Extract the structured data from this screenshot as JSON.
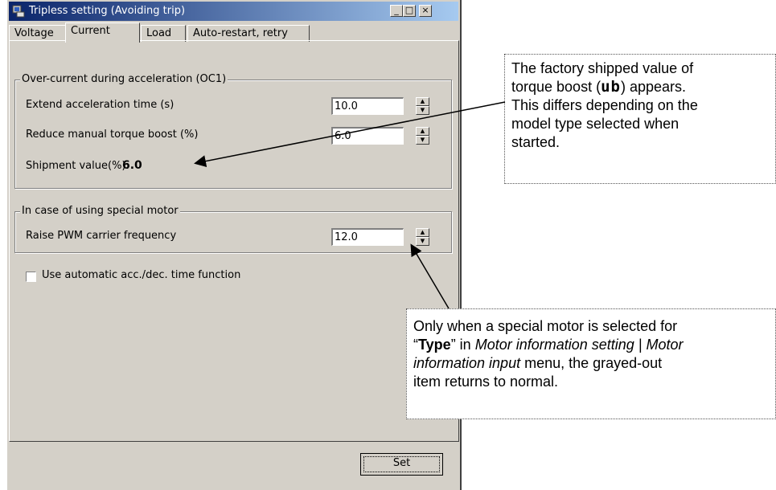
{
  "window": {
    "title": "Tripless setting (Avoiding trip)",
    "minimize": "_",
    "maximize": "□",
    "close": "×"
  },
  "tabs": [
    "Voltage",
    "Current",
    "Load",
    "Auto-restart, retry"
  ],
  "active_tab": "Current",
  "oc1_group": {
    "legend": "Over-current during acceleration (OC1)",
    "extend_label": "Extend acceleration time (s)",
    "extend_value": "10.0",
    "reduce_label": "Reduce manual torque boost (%)",
    "reduce_value": "6.0",
    "shipment_label": "Shipment value(%):",
    "shipment_value": "6.0"
  },
  "motor_group": {
    "legend": "In case of using special motor",
    "pwm_label": "Raise PWM carrier frequency",
    "pwm_value": "12.0"
  },
  "auto_acc_label": "Use automatic acc./dec. time function",
  "set_button": "Set",
  "callout1": {
    "line1": "The factory shipped value of",
    "line2a": "torque boost (",
    "line2_glyph": "ub",
    "line2b": ") appears.",
    "line3": "This differs depending on the",
    "line4": "model type selected when",
    "line5": "started."
  },
  "callout2": {
    "line1": "Only when a special motor is selected for",
    "q_open": "“",
    "type_word": "Type",
    "q_close": "” in ",
    "menu_italic": "Motor information setting | Motor",
    "menu_italic2": "information input",
    "line3_rest": " menu, the grayed-out",
    "line4": "item returns to normal."
  }
}
